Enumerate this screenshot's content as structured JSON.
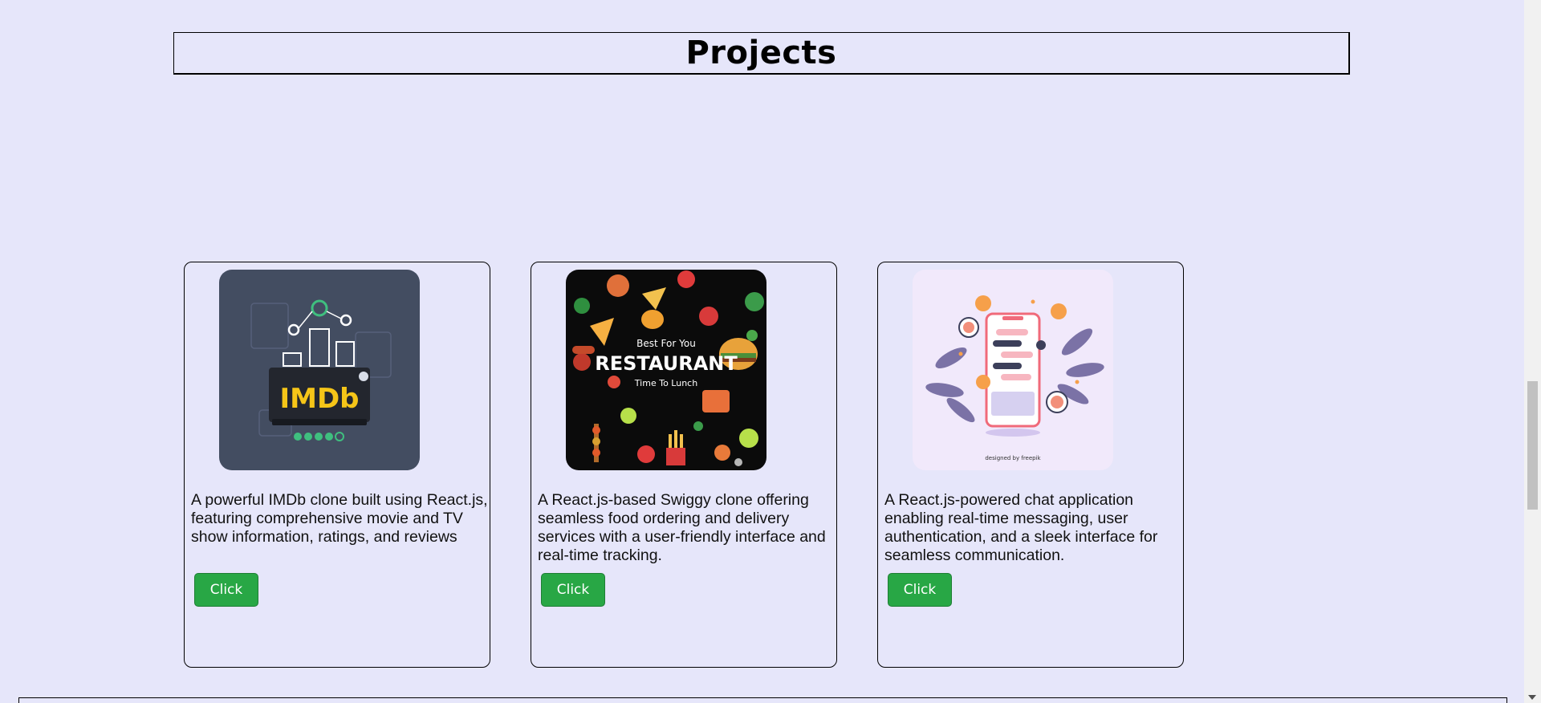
{
  "section": {
    "title": "Projects"
  },
  "projects": [
    {
      "image_subject": "imdb-clone-illustration",
      "image_logo": "IMDb",
      "description": "A powerful IMDb clone built using React.js, featuring comprehensive movie and TV show information, ratings, and reviews",
      "button_label": "Click"
    },
    {
      "image_subject": "restaurant-food-illustration",
      "image_line1": "Best For You",
      "image_line2": "RESTAURANT",
      "image_line3": "Time To Lunch",
      "description": "A React.js-based Swiggy clone offering seamless food ordering and delivery services with a user-friendly interface and real-time tracking.",
      "button_label": "Click"
    },
    {
      "image_subject": "chat-app-illustration",
      "image_credit": "designed by freepik",
      "description": "A React.js-powered chat application enabling real-time messaging, user authentication, and a sleek interface for seamless communication.",
      "button_label": "Click"
    }
  ],
  "colors": {
    "page_background": "#e6e6fa",
    "button_background": "#28a745",
    "button_text": "#ffffff"
  }
}
